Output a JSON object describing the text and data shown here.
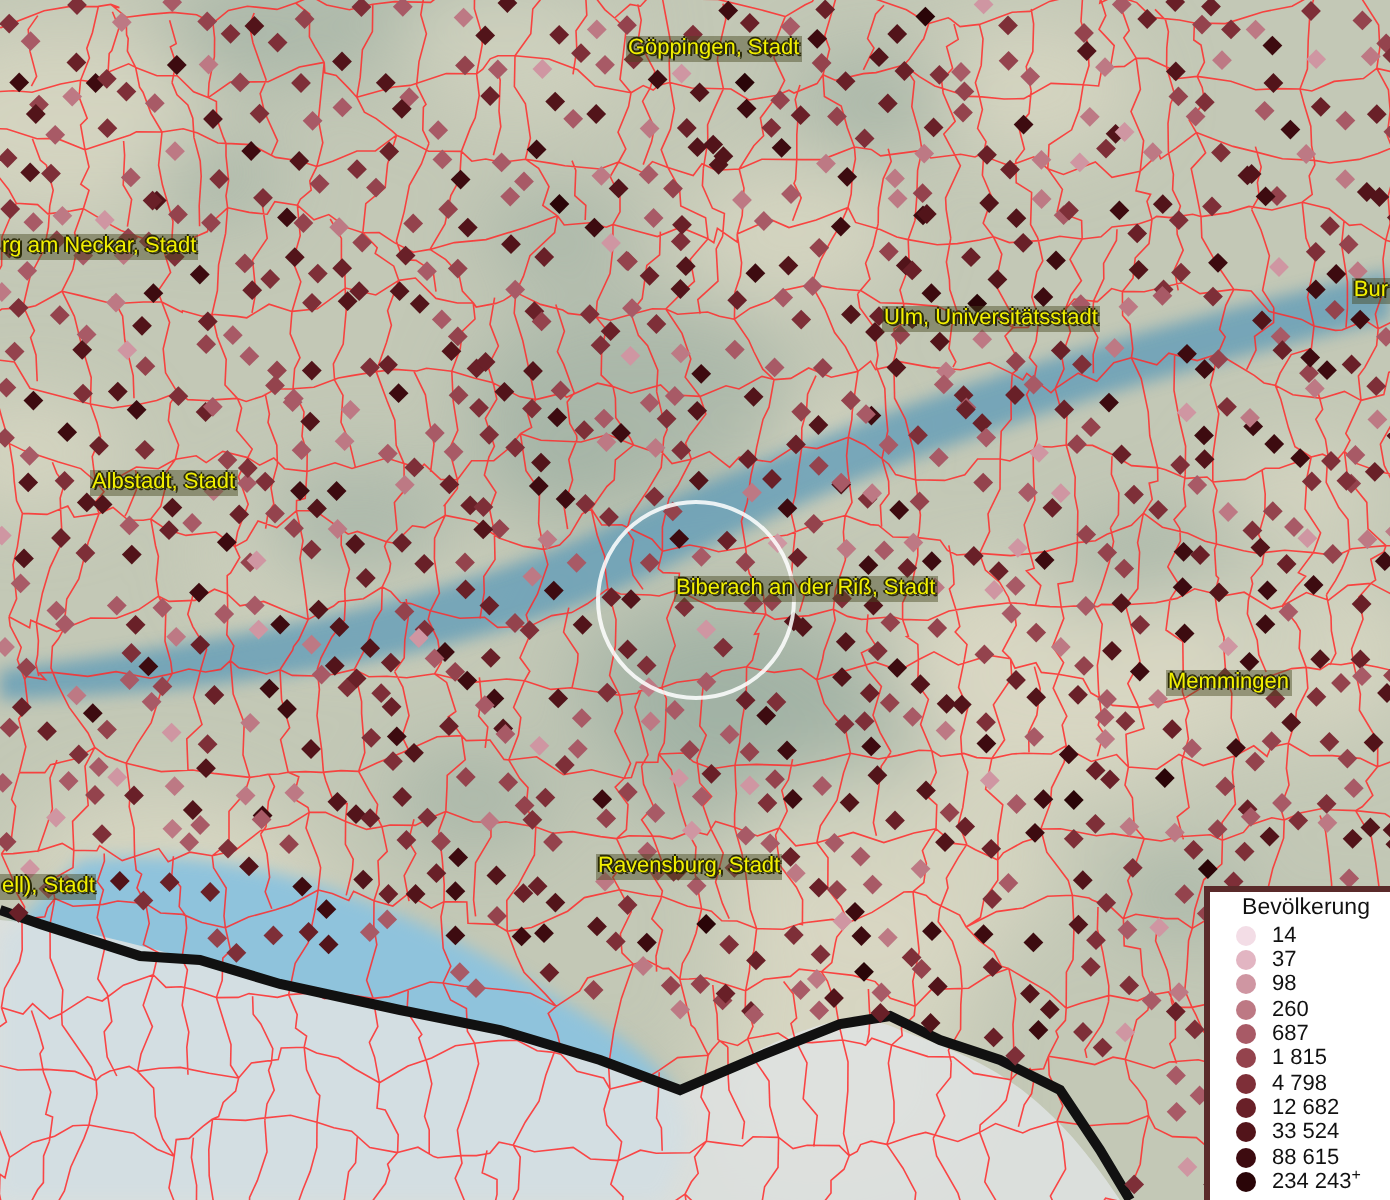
{
  "map": {
    "place_labels": [
      {
        "text": "Göppingen, Stadt"
      },
      {
        "text": "rg am Neckar, Stadt"
      },
      {
        "text": "Ulm, Universitätsstadt"
      },
      {
        "text": "Bur"
      },
      {
        "text": "Albstadt, Stadt"
      },
      {
        "text": "Biberach an der Riß, Stadt"
      },
      {
        "text": "Memmingen"
      },
      {
        "text": "Ravensburg, Stadt"
      },
      {
        "text": "ell), Stadt"
      }
    ]
  },
  "legend": {
    "title": "Bevölkerung",
    "items": [
      {
        "label": "14",
        "color": "#f3dde6"
      },
      {
        "label": "37",
        "color": "#e2b5c2"
      },
      {
        "label": "98",
        "color": "#cf96a2"
      },
      {
        "label": "260",
        "color": "#bd7984"
      },
      {
        "label": "687",
        "color": "#a85a66"
      },
      {
        "label": "1 815",
        "color": "#94434d"
      },
      {
        "label": "4 798",
        "color": "#7e2f38"
      },
      {
        "label": "12 682",
        "color": "#692028"
      },
      {
        "label": "33 524",
        "color": "#52141a"
      },
      {
        "label": "88 615",
        "color": "#3d0b10"
      },
      {
        "label": "234 243$^{+}$",
        "color": "#2a0508"
      }
    ]
  }
}
